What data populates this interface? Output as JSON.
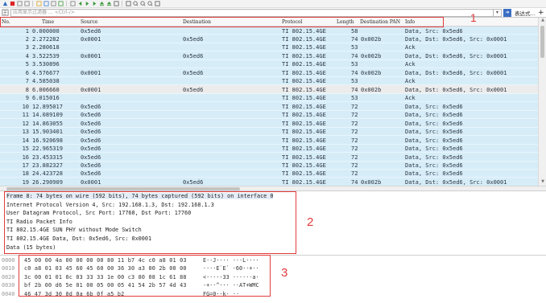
{
  "toolbar": {
    "icons": [
      "shark-fin-icon",
      "stop-icon",
      "restart-icon",
      "options-icon",
      "open-file-icon",
      "save-file-icon",
      "close-file-icon",
      "reload-icon",
      "find-icon",
      "back-icon",
      "forward-icon",
      "goto-icon",
      "first-icon",
      "last-icon",
      "autoscroll-icon",
      "colorize-icon",
      "zoom-in-icon",
      "zoom-out-icon",
      "zoom-reset-icon",
      "resize-columns-icon"
    ]
  },
  "filter": {
    "placeholder": "应用显示过滤器 … <Ctrl-/>",
    "expression_button": "表达式…",
    "add_button": "+"
  },
  "columns": {
    "no": "No.",
    "time": "Time",
    "source": "Source",
    "destination": "Destination",
    "protocol": "Protocol",
    "length": "Length",
    "dest_pan": "Destination PAN",
    "info": "Info"
  },
  "packets": [
    {
      "no": "1",
      "time": "0.000000",
      "src": "0x5ed6",
      "dst": "",
      "proto": "TI 802.15.4GE",
      "len": "58",
      "pan": "",
      "info": "Data, Src: 0x5ed6"
    },
    {
      "no": "2",
      "time": "2.272282",
      "src": "0x0001",
      "dst": "0x5ed6",
      "proto": "TI 802.15.4GE",
      "len": "74",
      "pan": "0x002b",
      "info": "Data, Dst: 0x5ed6, Src: 0x0001"
    },
    {
      "no": "3",
      "time": "2.280618",
      "src": "",
      "dst": "",
      "proto": "TI 802.15.4GE",
      "len": "53",
      "pan": "",
      "info": "Ack"
    },
    {
      "no": "4",
      "time": "3.522539",
      "src": "0x0001",
      "dst": "0x5ed6",
      "proto": "TI 802.15.4GE",
      "len": "74",
      "pan": "0x002b",
      "info": "Data, Dst: 0x5ed6, Src: 0x0001"
    },
    {
      "no": "5",
      "time": "3.530896",
      "src": "",
      "dst": "",
      "proto": "TI 802.15.4GE",
      "len": "53",
      "pan": "",
      "info": "Ack"
    },
    {
      "no": "6",
      "time": "4.576677",
      "src": "0x0001",
      "dst": "0x5ed6",
      "proto": "TI 802.15.4GE",
      "len": "74",
      "pan": "0x002b",
      "info": "Data, Dst: 0x5ed6, Src: 0x0001"
    },
    {
      "no": "7",
      "time": "4.585038",
      "src": "",
      "dst": "",
      "proto": "TI 802.15.4GE",
      "len": "53",
      "pan": "",
      "info": "Ack"
    },
    {
      "no": "8",
      "time": "6.006660",
      "src": "0x0001",
      "dst": "0x5ed6",
      "proto": "TI 802.15.4GE",
      "len": "74",
      "pan": "0x002b",
      "info": "Data, Dst: 0x5ed6, Src: 0x0001",
      "selected": true
    },
    {
      "no": "9",
      "time": "6.015016",
      "src": "",
      "dst": "",
      "proto": "TI 802.15.4GE",
      "len": "53",
      "pan": "",
      "info": "Ack"
    },
    {
      "no": "10",
      "time": "12.895017",
      "src": "0x5ed6",
      "dst": "",
      "proto": "TI 802.15.4GE",
      "len": "72",
      "pan": "",
      "info": "Data, Src: 0x5ed6"
    },
    {
      "no": "11",
      "time": "14.089109",
      "src": "0x5ed6",
      "dst": "",
      "proto": "TI 802.15.4GE",
      "len": "72",
      "pan": "",
      "info": "Data, Src: 0x5ed6"
    },
    {
      "no": "12",
      "time": "14.863055",
      "src": "0x5ed6",
      "dst": "",
      "proto": "TI 802.15.4GE",
      "len": "72",
      "pan": "",
      "info": "Data, Src: 0x5ed6"
    },
    {
      "no": "13",
      "time": "15.903401",
      "src": "0x5ed6",
      "dst": "",
      "proto": "TI 802.15.4GE",
      "len": "72",
      "pan": "",
      "info": "Data, Src: 0x5ed6"
    },
    {
      "no": "14",
      "time": "16.920698",
      "src": "0x5ed6",
      "dst": "",
      "proto": "TI 802.15.4GE",
      "len": "72",
      "pan": "",
      "info": "Data, Src: 0x5ed6"
    },
    {
      "no": "15",
      "time": "22.965319",
      "src": "0x5ed6",
      "dst": "",
      "proto": "TI 802.15.4GE",
      "len": "72",
      "pan": "",
      "info": "Data, Src: 0x5ed6"
    },
    {
      "no": "16",
      "time": "23.453315",
      "src": "0x5ed6",
      "dst": "",
      "proto": "TI 802.15.4GE",
      "len": "72",
      "pan": "",
      "info": "Data, Src: 0x5ed6"
    },
    {
      "no": "17",
      "time": "23.882327",
      "src": "0x5ed6",
      "dst": "",
      "proto": "TI 802.15.4GE",
      "len": "72",
      "pan": "",
      "info": "Data, Src: 0x5ed6"
    },
    {
      "no": "18",
      "time": "24.423728",
      "src": "0x5ed6",
      "dst": "",
      "proto": "TI 802.15.4GE",
      "len": "72",
      "pan": "",
      "info": "Data, Src: 0x5ed6"
    },
    {
      "no": "19",
      "time": "26.290909",
      "src": "0x0001",
      "dst": "0x5ed6",
      "proto": "TI 802.15.4GE",
      "len": "74",
      "pan": "0x002b",
      "info": "Data, Dst: 0x5ed6, Src: 0x0001"
    }
  ],
  "details": [
    "Frame 8: 74 bytes on wire (592 bits), 74 bytes captured (592 bits) on interface 0",
    "Internet Protocol Version 4, Src: 192.168.1.3, Dst: 192.168.1.3",
    "User Datagram Protocol, Src Port: 17760, Dst Port: 17760",
    "TI Radio Packet Info",
    "TI 802.15.4GE SUN PHY without Mode Switch",
    "TI 802.15.4GE Data, Dst: 0x5ed6, Src: 0x0001",
    "Data (15 bytes)"
  ],
  "bytes": [
    {
      "offset": "0000",
      "hex": "45 00 00 4a 00 00 00 00  80 11 b7 4c c0 a8 01 03",
      "ascii": "E··J····  ···L····"
    },
    {
      "offset": "0010",
      "hex": "c0 a8 01 03 45 60 45 60  00 36 30 a3 00 2b 00 00",
      "ascii": "····E`E`  ·60··+··"
    },
    {
      "offset": "0020",
      "hex": "3c 00 01 01 0c 03 33 33  1e 00 c3 80 08 1c 61 88",
      "ascii": "<·····33  ······a·"
    },
    {
      "offset": "0030",
      "hex": "bf 2b 00 d6 5e 01 00 05  00 05 41 54 2b 57 4d 43",
      "ascii": "·+··^···  ··AT+WMC"
    },
    {
      "offset": "0040",
      "hex": "46 47 3d 30 0d 0a 6b 0f  a5 b2",
      "ascii": "FG=0··k·  ··"
    }
  ],
  "annotations": [
    "1",
    "2",
    "3"
  ],
  "colors": {
    "row": "#d6edf8",
    "selected_row": "#ececec",
    "annotation": "#e23b3b"
  }
}
